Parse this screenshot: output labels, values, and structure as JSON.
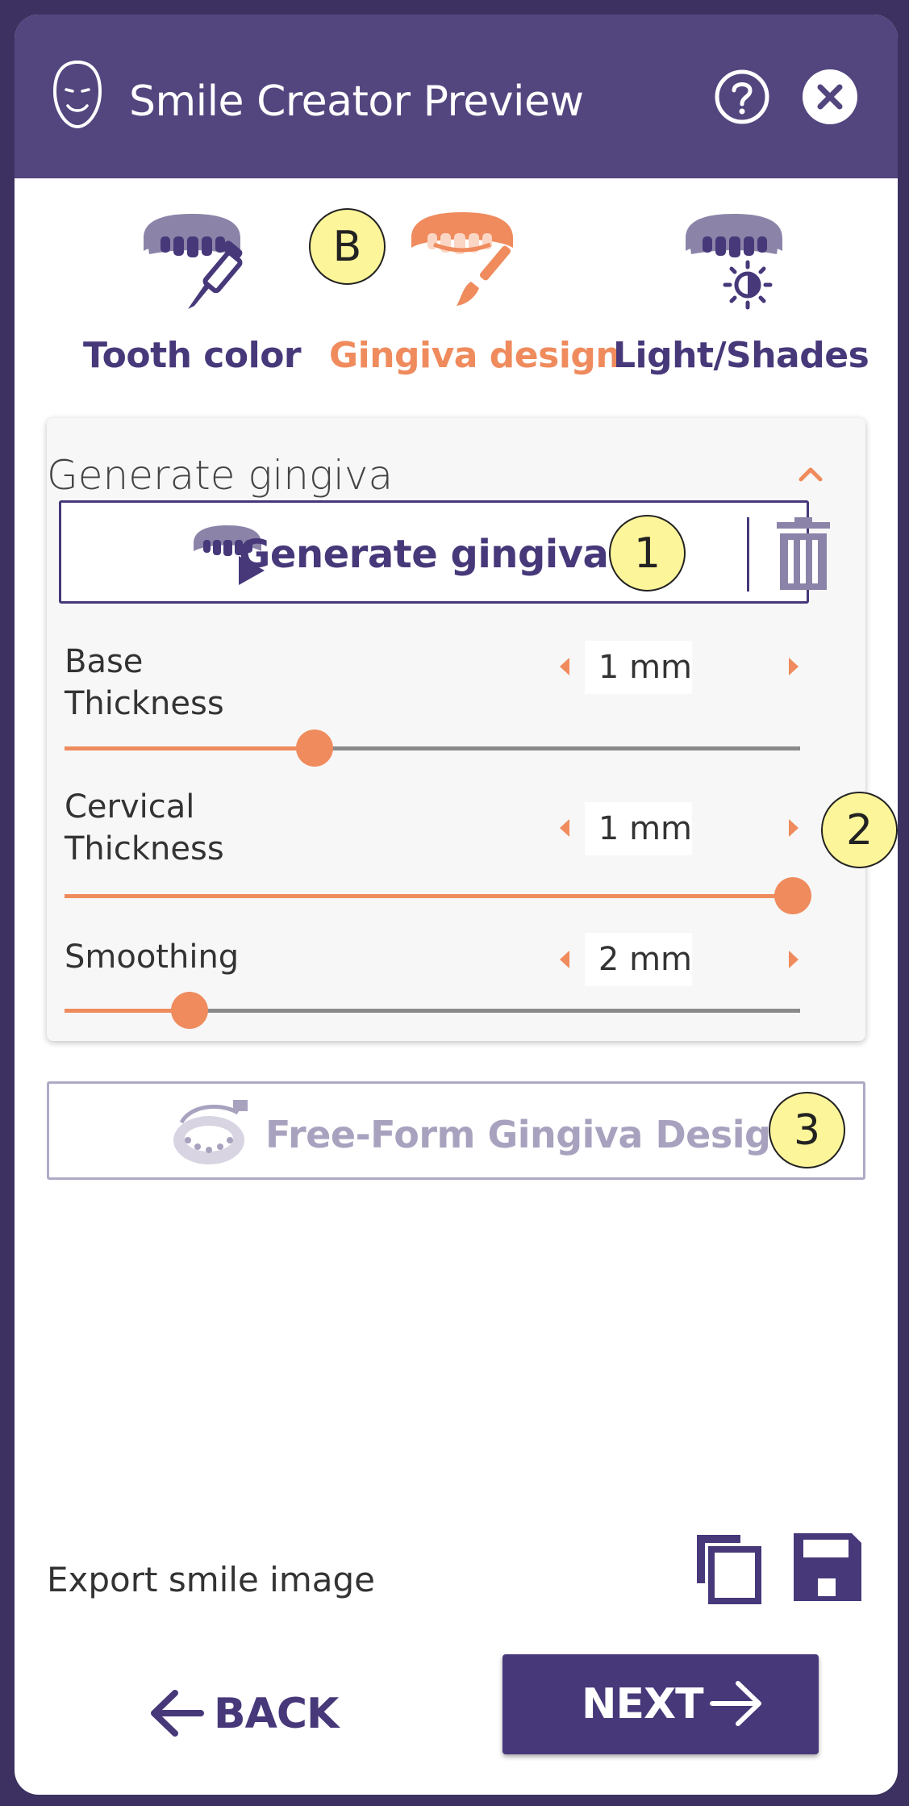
{
  "window": {
    "title": "Smile Creator Preview",
    "icons": {
      "logo": "face-icon",
      "help": "help-icon",
      "close": "close-icon"
    }
  },
  "tabs": [
    {
      "label": "Tooth color",
      "icon": "tooth-color-dropper-icon",
      "active": false
    },
    {
      "label": "Gingiva design",
      "icon": "gingiva-brush-icon",
      "active": true
    },
    {
      "label": "Light/Shades",
      "icon": "light-shades-icon",
      "active": false
    }
  ],
  "callouts": {
    "tabs": "B",
    "generate": "1",
    "params": "2",
    "freeform": "3"
  },
  "panel": {
    "title": "Generate gingiva",
    "generate_button_label": "Generate gingiva",
    "params": [
      {
        "label_line1": "Base",
        "label_line2": "Thickness",
        "value": "1 mm",
        "level": 0.34
      },
      {
        "label_line1": "Cervical",
        "label_line2": "Thickness",
        "value": "1 mm",
        "level": 0.99
      },
      {
        "label_line1": "Smoothing",
        "label_line2": "",
        "value": "2 mm",
        "level": 0.17
      }
    ]
  },
  "freeform_button_label": "Free-Form Gingiva Design",
  "export_label": "Export smile image",
  "nav": {
    "back_label": "BACK",
    "next_label": "NEXT"
  },
  "colors": {
    "header": "#53457e",
    "primary": "#47387a",
    "accent": "#ef8b5d",
    "disabled": "#a8a2bf",
    "callout": "#fdf59a"
  }
}
